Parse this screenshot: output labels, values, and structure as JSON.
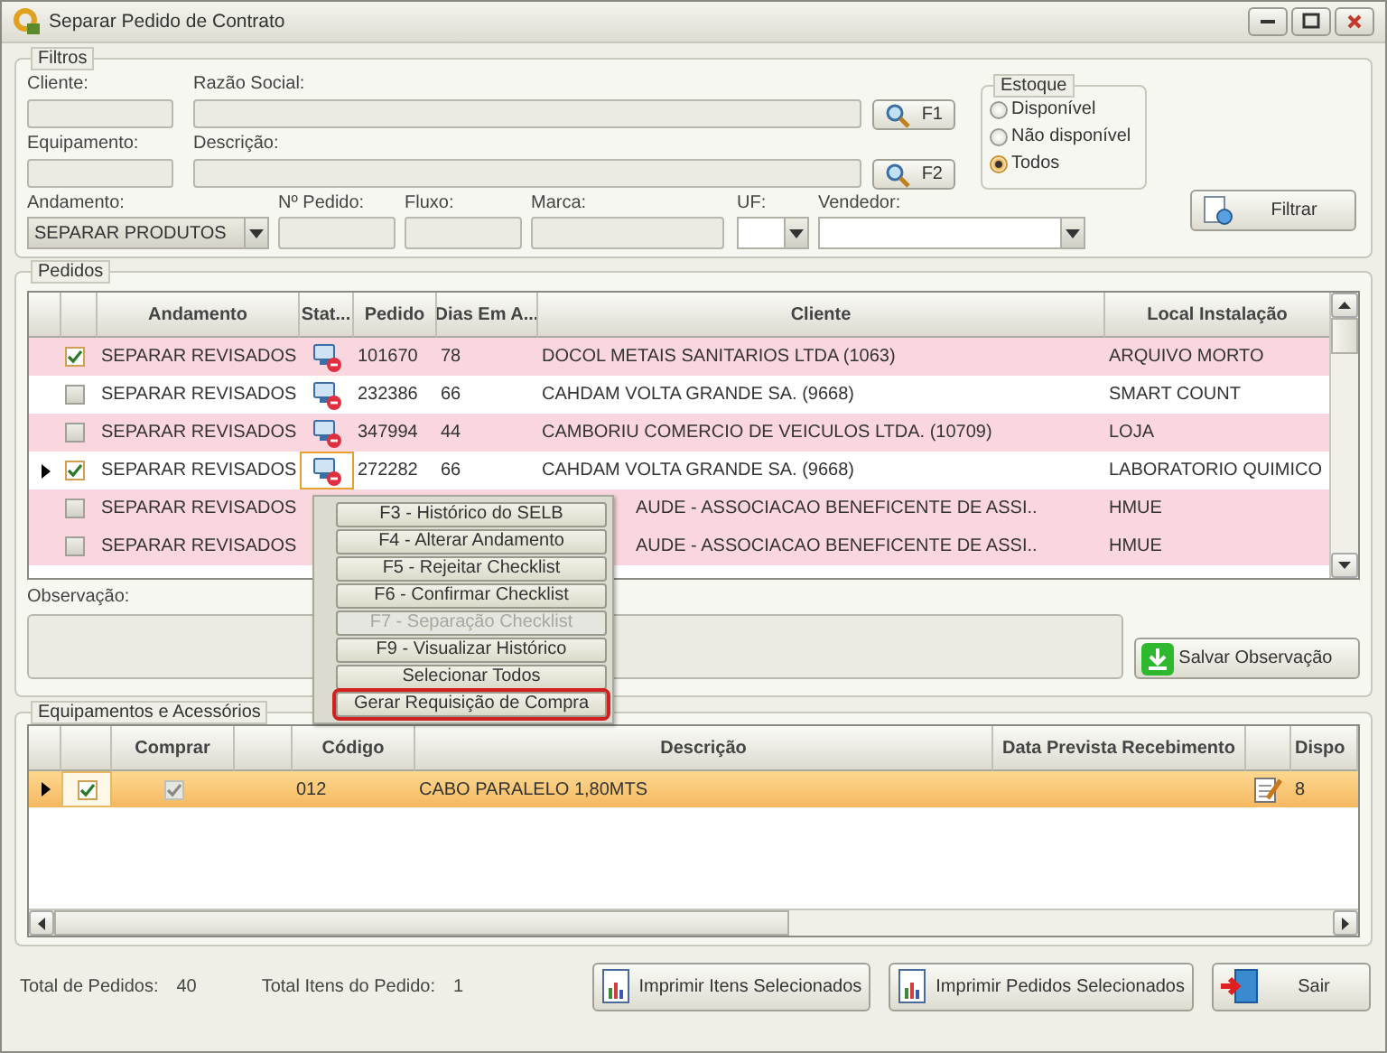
{
  "window": {
    "title": "Separar Pedido de Contrato"
  },
  "filtros": {
    "title": "Filtros",
    "top_fields": [
      {
        "label": "Cliente:",
        "kind": "short"
      },
      {
        "label": "Razão Social:",
        "kind": "long",
        "button": "F1"
      },
      {
        "label": "Equipamento:",
        "kind": "short"
      },
      {
        "label": "Descrição:",
        "kind": "long",
        "button": "F2"
      }
    ],
    "estoque": {
      "title": "Estoque",
      "options": [
        {
          "label": "Disponível",
          "selected": false
        },
        {
          "label": "Não disponível",
          "selected": false
        },
        {
          "label": "Todos",
          "selected": true
        }
      ]
    },
    "bottom_fields": [
      {
        "label": "Andamento:",
        "kind": "combo",
        "value": "SEPARAR PRODUTOS"
      },
      {
        "label": "Nº Pedido:",
        "kind": "text"
      },
      {
        "label": "Fluxo:",
        "kind": "text"
      },
      {
        "label": "Marca:",
        "kind": "wide"
      },
      {
        "label": "UF:",
        "kind": "small-combo"
      },
      {
        "label": "Vendedor:",
        "kind": "wide-combo"
      }
    ],
    "filtrar_button": "Filtrar"
  },
  "pedidos": {
    "title": "Pedidos",
    "columns": [
      "Andamento",
      "Stat...",
      "Pedido",
      "Dias Em A...",
      "Cliente",
      "Local Instalação"
    ],
    "rows": [
      {
        "current": false,
        "checked": true,
        "color": "#fad7df",
        "andamento": "SEPARAR REVISADOS",
        "status_icon": true,
        "pedido": "101670",
        "dias": "78",
        "cliente": "DOCOL METAIS SANITARIOS LTDA (1063)",
        "local": "ARQUIVO MORTO"
      },
      {
        "current": false,
        "checked": false,
        "color": "#ffffff",
        "andamento": "SEPARAR REVISADOS",
        "status_icon": true,
        "pedido": "232386",
        "dias": "66",
        "cliente": "CAHDAM VOLTA GRANDE SA. (9668)",
        "local": "SMART COUNT"
      },
      {
        "current": false,
        "checked": false,
        "color": "#fad7df",
        "andamento": "SEPARAR REVISADOS",
        "status_icon": true,
        "pedido": "347994",
        "dias": "44",
        "cliente": "CAMBORIU COMERCIO DE VEICULOS LTDA. (10709)",
        "local": "LOJA"
      },
      {
        "current": true,
        "checked": true,
        "color": "#ffffff",
        "andamento": "SEPARAR REVISADOS",
        "status_icon": true,
        "pedido": "272282",
        "dias": "66",
        "cliente": "CAHDAM VOLTA GRANDE SA. (9668)",
        "local": "LABORATORIO QUIMICO"
      },
      {
        "current": false,
        "checked": false,
        "color": "#fad7df",
        "andamento": "SEPARAR REVISADOS",
        "status_icon": false,
        "cliente": "AUDE - ASSOCIACAO BENEFICENTE DE ASSI..",
        "local": "HMUE"
      },
      {
        "current": false,
        "checked": false,
        "color": "#fad7df",
        "andamento": "SEPARAR REVISADOS",
        "status_icon": false,
        "cliente": "AUDE - ASSOCIACAO BENEFICENTE DE ASSI..",
        "local": "HMUE"
      }
    ],
    "observacao_label": "Observação:",
    "salvar_button": "Salvar Observação"
  },
  "context_menu": [
    {
      "label": "F3 - Histórico do SELB",
      "disabled": false,
      "outlined": false
    },
    {
      "label": "F4 - Alterar Andamento",
      "disabled": false,
      "outlined": false
    },
    {
      "label": "F5 - Rejeitar Checklist",
      "disabled": false,
      "outlined": false
    },
    {
      "label": "F6 - Confirmar Checklist",
      "disabled": false,
      "outlined": false
    },
    {
      "label": "F7 - Separação Checklist",
      "disabled": true,
      "outlined": false
    },
    {
      "label": "F9 - Visualizar Histórico",
      "disabled": false,
      "outlined": false
    },
    {
      "label": "Selecionar Todos",
      "disabled": false,
      "outlined": false
    },
    {
      "label": "Gerar Requisição de Compra",
      "disabled": false,
      "outlined": true
    }
  ],
  "equipamentos": {
    "title": "Equipamentos e Acessórios",
    "columns": [
      "Comprar",
      "Código",
      "Descrição",
      "Data Prevista Recebimento",
      "Dispo"
    ],
    "rows": [
      {
        "current": true,
        "checked": true,
        "comprar": true,
        "codigo": "012",
        "descricao": "CABO PARALELO 1,80MTS",
        "dispo": "8"
      }
    ]
  },
  "footer": {
    "total_pedidos_label": "Total de Pedidos:",
    "total_pedidos": "40",
    "total_itens_label": "Total Itens do Pedido:",
    "total_itens": "1",
    "buttons": [
      {
        "kind": "print",
        "label": "Imprimir Itens Selecionados"
      },
      {
        "kind": "print",
        "label": "Imprimir Pedidos Selecionados"
      },
      {
        "kind": "exit",
        "label": "Sair"
      }
    ]
  }
}
